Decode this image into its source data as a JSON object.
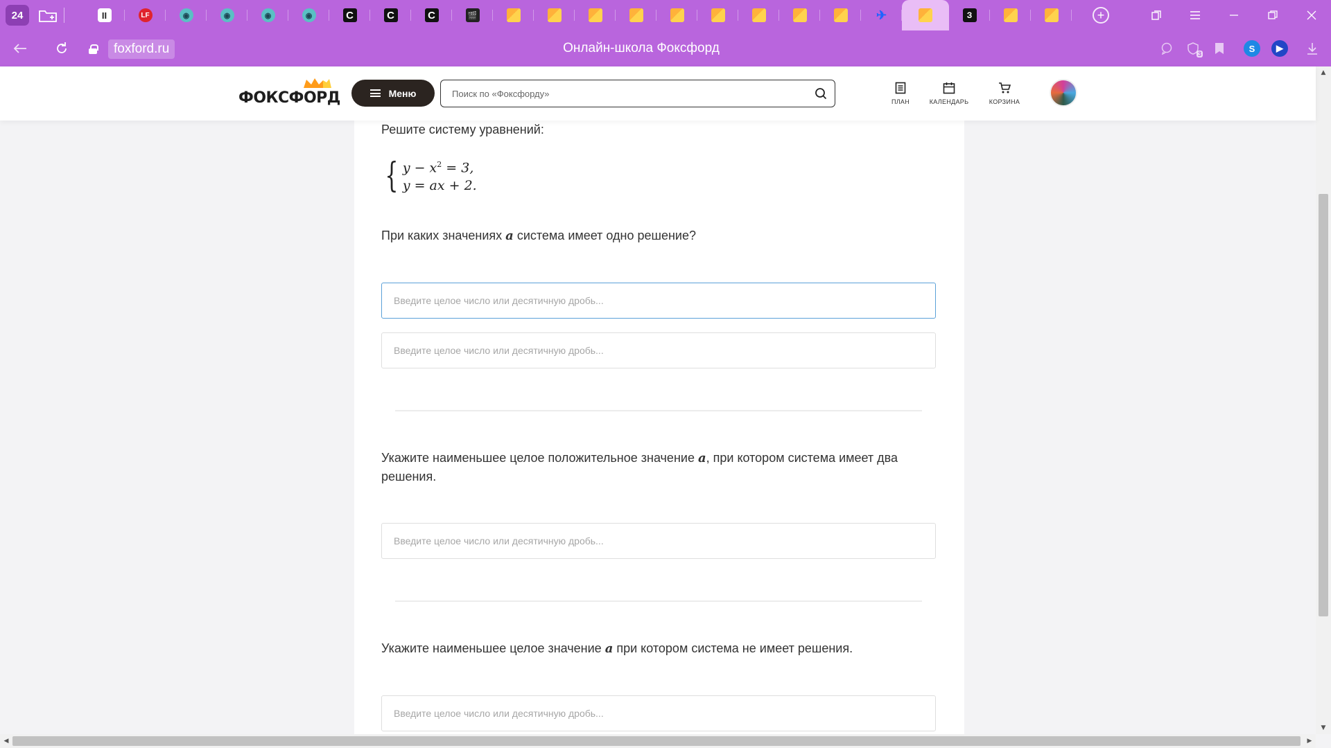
{
  "browser": {
    "tab_count": "24",
    "tabs": [
      {
        "favicon": "pause-icon",
        "glyph": "II"
      },
      {
        "favicon": "lf-icon",
        "glyph": "LF"
      },
      {
        "favicon": "gamepad-icon",
        "glyph": "◉"
      },
      {
        "favicon": "gamepad-icon",
        "glyph": "◉"
      },
      {
        "favicon": "gamepad-icon",
        "glyph": "◉"
      },
      {
        "favicon": "gamepad-icon",
        "glyph": "◉"
      },
      {
        "favicon": "c-icon",
        "glyph": "C"
      },
      {
        "favicon": "c-icon",
        "glyph": "C"
      },
      {
        "favicon": "c-icon",
        "glyph": "C"
      },
      {
        "favicon": "clapperboard-icon",
        "glyph": "🎬"
      },
      {
        "favicon": "foxford-icon",
        "glyph": ""
      },
      {
        "favicon": "foxford-icon",
        "glyph": ""
      },
      {
        "favicon": "foxford-icon",
        "glyph": ""
      },
      {
        "favicon": "foxford-icon",
        "glyph": ""
      },
      {
        "favicon": "foxford-icon",
        "glyph": ""
      },
      {
        "favicon": "foxford-icon",
        "glyph": ""
      },
      {
        "favicon": "foxford-icon",
        "glyph": ""
      },
      {
        "favicon": "foxford-icon",
        "glyph": ""
      },
      {
        "favicon": "foxford-icon",
        "glyph": ""
      },
      {
        "favicon": "bird-icon",
        "glyph": "✈"
      },
      {
        "favicon": "foxford-icon",
        "glyph": "",
        "active": true
      },
      {
        "favicon": "z-icon",
        "glyph": "З"
      },
      {
        "favicon": "foxford-icon",
        "glyph": ""
      },
      {
        "favicon": "foxford-icon",
        "glyph": ""
      }
    ],
    "url": "foxford.ru",
    "page_title": "Онлайн-школа Фоксфорд",
    "accent_color": "#b965dd"
  },
  "header": {
    "logo_text": "ФОКСФОРД",
    "menu_label": "Меню",
    "search_placeholder": "Поиск по «Фоксфорду»",
    "nav": [
      {
        "label": "ПЛАН",
        "icon": "plan-icon"
      },
      {
        "label": "КАЛЕНДАРЬ",
        "icon": "calendar-icon"
      },
      {
        "label": "КОРЗИНА",
        "icon": "cart-icon"
      }
    ]
  },
  "task": {
    "intro": "Решите систему уравнений:",
    "equations": [
      "y − x",
      "2",
      " = 3,",
      "y = ax + 2."
    ],
    "questions": [
      {
        "before": "При каких значениях ",
        "var": "a",
        "after": " система имеет одно решение?"
      },
      {
        "before": "Укажите наименьшее целое положительное значение ",
        "var": "a",
        "after": ", при котором система имеет два решения."
      },
      {
        "before": "Укажите наименьшее целое значение ",
        "var": "a",
        "after": " при котором система не имеет решения."
      }
    ],
    "answer_placeholder": "Введите целое число или десятичную дробь..."
  }
}
